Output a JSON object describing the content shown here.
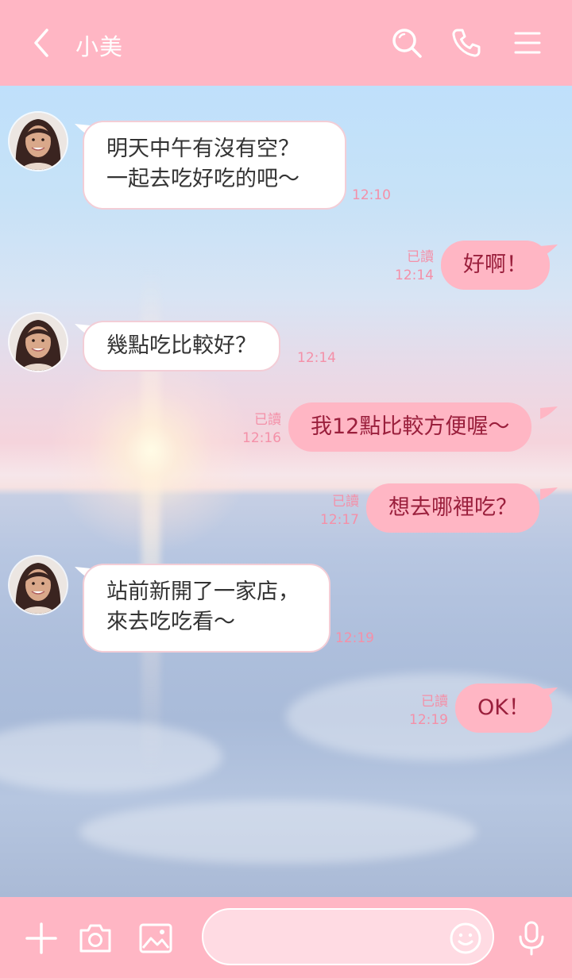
{
  "header": {
    "title": "小美",
    "back_icon": "chevron-left-icon",
    "search_icon": "search-icon",
    "call_icon": "phone-icon",
    "menu_icon": "hamburger-menu-icon"
  },
  "colors": {
    "accent": "#ffb6c4",
    "outgoing_text": "#9a1f3c",
    "timestamp": "#f490a8"
  },
  "messages": [
    {
      "direction": "in",
      "lines": [
        "明天中午有沒有空？",
        "一起去吃好吃的吧～"
      ],
      "time": "12:10"
    },
    {
      "direction": "out",
      "lines": [
        "好啊！"
      ],
      "time": "12:14",
      "read": "已讀"
    },
    {
      "direction": "in",
      "lines": [
        "幾點吃比較好？"
      ],
      "time": "12:14"
    },
    {
      "direction": "out",
      "lines": [
        "我12點比較方便喔～"
      ],
      "time": "12:16",
      "read": "已讀"
    },
    {
      "direction": "out",
      "lines": [
        "想去哪裡吃？"
      ],
      "time": "12:17",
      "read": "已讀"
    },
    {
      "direction": "in",
      "lines": [
        "站前新開了一家店，",
        "來去吃吃看～"
      ],
      "time": "12:19"
    },
    {
      "direction": "out",
      "lines": [
        "OK！"
      ],
      "time": "12:19",
      "read": "已讀"
    }
  ],
  "footer": {
    "add_icon": "plus-icon",
    "camera_icon": "camera-icon",
    "image_icon": "image-icon",
    "input_placeholder": "",
    "emoji_icon": "smiley-icon",
    "mic_icon": "microphone-icon"
  }
}
